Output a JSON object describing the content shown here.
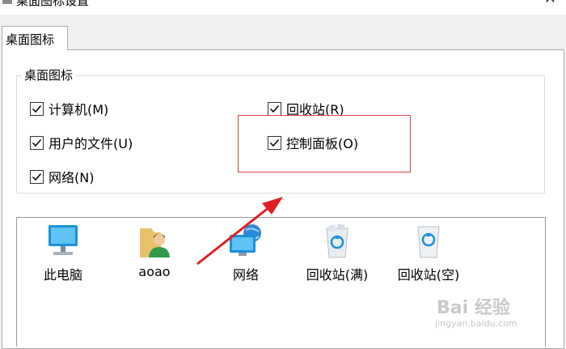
{
  "window": {
    "title": "桌面图标设置"
  },
  "tabs": [
    {
      "label": "桌面图标"
    }
  ],
  "group": {
    "legend": "桌面图标",
    "checkboxes": [
      {
        "label": "计算机(M)",
        "checked": true
      },
      {
        "label": "回收站(R)",
        "checked": true
      },
      {
        "label": "用户的文件(U)",
        "checked": true
      },
      {
        "label": "控制面板(O)",
        "checked": true
      },
      {
        "label": "网络(N)",
        "checked": true
      }
    ]
  },
  "icons": [
    {
      "label": "此电脑",
      "icon": "computer-icon"
    },
    {
      "label": "aoao",
      "icon": "user-folder-icon"
    },
    {
      "label": "网络",
      "icon": "network-icon"
    },
    {
      "label": "回收站(满)",
      "icon": "recycle-bin-full-icon"
    },
    {
      "label": "回收站(空)",
      "icon": "recycle-bin-empty-icon"
    }
  ],
  "watermark": {
    "brand": "Bai 经验",
    "url": "jingyan.baidu.com"
  },
  "colors": {
    "highlight": "#d9423f",
    "arrow": "#e02020"
  }
}
